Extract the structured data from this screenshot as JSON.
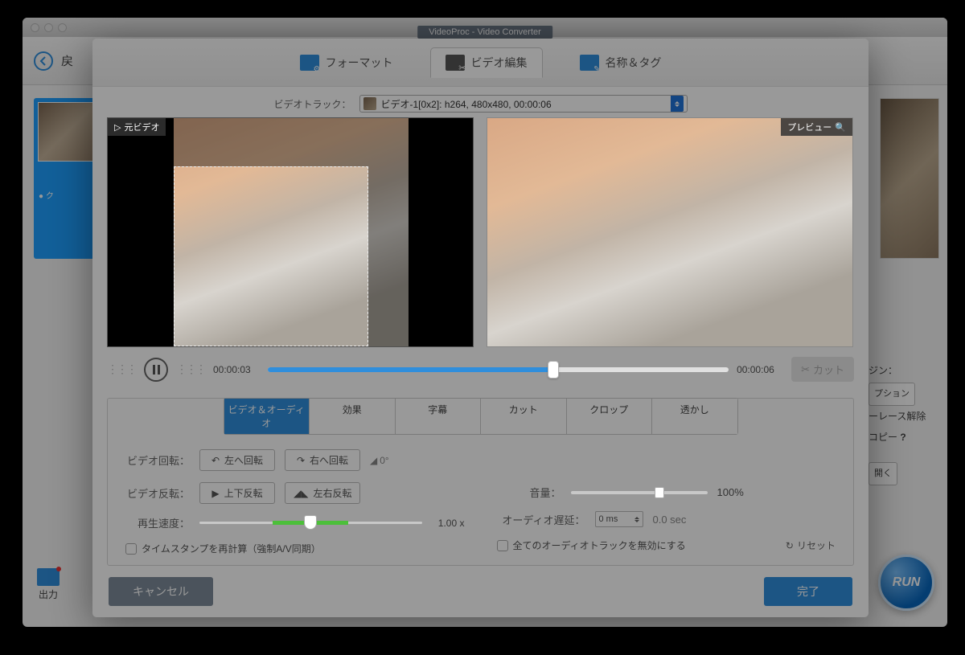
{
  "window_title": "VideoProc - Video Converter",
  "back_label": "戻",
  "main_tabs": {
    "format": "フォーマット",
    "edit": "ビデオ編集",
    "nametag": "名称＆タグ"
  },
  "track_label": "ビデオトラック：",
  "track_value": "ビデオ-1[0x2]: h264, 480x480, 00:00:06",
  "preview_left": "元ビデオ",
  "preview_right": "プレビュー",
  "time_start": "00:00:03",
  "time_end": "00:00:06",
  "cut_btn": "カット",
  "sub_tabs": [
    "ビデオ＆オーディオ",
    "効果",
    "字幕",
    "カット",
    "クロップ",
    "透かし"
  ],
  "panel": {
    "rotate_label": "ビデオ回転：",
    "rotate_left": "左へ回転",
    "rotate_right": "右へ回転",
    "angle": "0°",
    "flip_label": "ビデオ反転：",
    "flip_v": "上下反転",
    "flip_h": "左右反転",
    "speed_label": "再生速度：",
    "speed_val": "1.00",
    "speed_suffix": "x",
    "volume_label": "音量：",
    "volume_val": "100%",
    "delay_label": "オーディオ遅延：",
    "delay_val": "0 ms",
    "delay_sec": "0.0 sec",
    "recalc_ts": "タイムスタンプを再計算（強制A/V同期）",
    "disable_audio": "全てのオーディオトラックを無効にする",
    "reset": "リセット"
  },
  "foot": {
    "cancel": "キャンセル",
    "done": "完了"
  },
  "bg": {
    "engine": "ジン：",
    "option": "プション",
    "deinterlace": "ーレース解除",
    "copy": "コピー",
    "open": "開く",
    "output": "出力",
    "run": "RUN",
    "q": "?"
  }
}
